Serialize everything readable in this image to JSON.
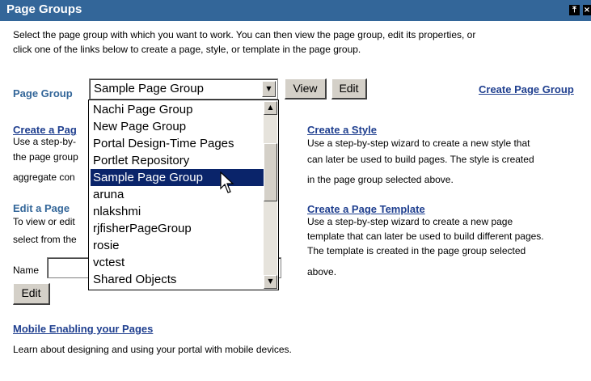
{
  "portlet": {
    "title": "Page Groups",
    "icons": [
      "collapse-icon",
      "close-icon"
    ]
  },
  "intro": {
    "line1": "Select the page group with which you want to work. You can then view the page group, edit its properties, or",
    "line2": "click one of the links below to create a page, style, or template in the page group."
  },
  "page_group": {
    "label": "Page Group",
    "selected": "Sample Page Group",
    "options": [
      "Nachi Page Group",
      "New Page Group",
      "Portal Design-Time Pages",
      "Portlet Repository",
      "Sample Page Group",
      "aruna",
      "nlakshmi",
      "rjfisherPageGroup",
      "rosie",
      "vctest",
      "Shared Objects"
    ],
    "view_label": "View",
    "edit_label": "Edit",
    "create_link": "Create Page Group"
  },
  "create_page": {
    "link": "Create a Pag",
    "lines": [
      "Use a step-by-",
      "the page group",
      "aggregate con"
    ]
  },
  "edit_page": {
    "heading": "Edit a Page",
    "lines": [
      "To view or edit",
      "select from the"
    ],
    "name_label": "Name",
    "edit_label": "Edit"
  },
  "create_style": {
    "link": "Create a Style",
    "lines": [
      "Use a step-by-step wizard to create a new style that",
      "can later be used to build pages. The style is created",
      "in the page group selected above."
    ]
  },
  "create_template": {
    "link": "Create a Page Template",
    "lines": [
      "Use a step-by-step wizard to create a new page",
      "template that can later be used to build different pages.",
      "The template is created in the page group selected",
      "above."
    ]
  },
  "mobile": {
    "link": "Mobile Enabling your Pages",
    "desc": "Learn about designing and using your portal with mobile devices."
  },
  "colors": {
    "titlebar": "#336699",
    "link": "#1f3f8f",
    "selection": "#0a246a"
  }
}
